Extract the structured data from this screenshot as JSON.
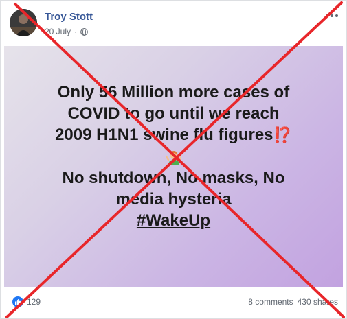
{
  "post": {
    "author": "Troy Stott",
    "date": "20 July",
    "separator": "·",
    "privacy_icon": "globe-icon",
    "menu_icon": "more-options-icon"
  },
  "image_card": {
    "line1": "Only 56 Million more cases of",
    "line2": "COVID to go until we reach",
    "line3": "2009 H1N1 swine flu figures",
    "line3_emoji": "⁉️",
    "shrug_emoji_icon": "person-shrugging-icon",
    "line4": "No shutdown, No masks, No",
    "line5": "media hysteria",
    "hashtag": "#WakeUp"
  },
  "footer": {
    "reaction_icon": "like-icon",
    "reaction_count": "129",
    "comments": "8 comments",
    "shares": "430 shares"
  },
  "overlay": {
    "type": "red-x-cross",
    "color": "#e8262a"
  }
}
